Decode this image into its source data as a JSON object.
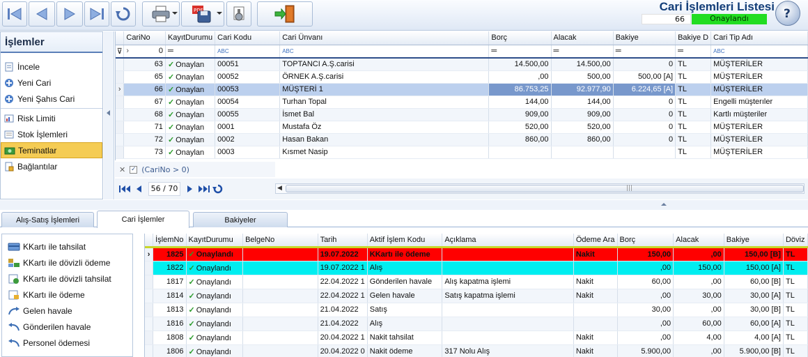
{
  "header": {
    "title": "Cari İşlemleri Listesi",
    "record_number": "66",
    "status": "Onaylandı"
  },
  "toolbar": {
    "icons": [
      "first-record-icon",
      "previous-record-icon",
      "next-record-icon",
      "last-record-icon",
      "refresh-icon",
      "print-icon",
      "pdf-save-icon",
      "settings-icon",
      "exit-icon",
      "help-icon"
    ]
  },
  "sidebar": {
    "title": "İşlemler",
    "items": [
      {
        "label": "İncele",
        "icon": "view-icon"
      },
      {
        "label": "Yeni Cari",
        "icon": "add-icon"
      },
      {
        "label": "Yeni Şahıs Cari",
        "icon": "add-icon"
      },
      {
        "label": "Risk Limiti",
        "icon": "risk-icon"
      },
      {
        "label": "Stok İşlemleri",
        "icon": "stock-icon"
      },
      {
        "label": "Teminatlar",
        "icon": "guarantee-icon"
      },
      {
        "label": "Bağlantılar",
        "icon": "link-icon"
      }
    ]
  },
  "top_grid": {
    "columns": [
      "CariNo",
      "KayıtDurumu",
      "Cari Kodu",
      "Cari Ünvanı",
      "Borç",
      "Alacak",
      "Bakiye",
      "Bakiye D",
      "Cari Tip Adı"
    ],
    "filter_row": {
      "cari_no": "0"
    },
    "rows": [
      {
        "cari_no": "63",
        "durum": "Onaylan",
        "kod": "00051",
        "unvan": "TOPTANCI A.Ş.carisi",
        "borc": "14.500,00",
        "alacak": "14.500,00",
        "bakiye": "0",
        "doviz": "TL",
        "tip": "MÜŞTERİLER"
      },
      {
        "cari_no": "65",
        "durum": "Onaylan",
        "kod": "00052",
        "unvan": "ÖRNEK A.Ş.carisi",
        "borc": ",00",
        "alacak": "500,00",
        "bakiye": "500,00 [A]",
        "doviz": "TL",
        "tip": "MÜŞTERİLER"
      },
      {
        "cari_no": "66",
        "durum": "Onaylan",
        "kod": "00053",
        "unvan": "MÜŞTERİ 1",
        "borc": "86.753,25",
        "alacak": "92.977,90",
        "bakiye": "6.224,65 [A]",
        "doviz": "TL",
        "tip": "MÜŞTERİLER"
      },
      {
        "cari_no": "67",
        "durum": "Onaylan",
        "kod": "00054",
        "unvan": "Turhan Topal",
        "borc": "144,00",
        "alacak": "144,00",
        "bakiye": "0",
        "doviz": "TL",
        "tip": "Engelli müşterıler"
      },
      {
        "cari_no": "68",
        "durum": "Onaylan",
        "kod": "00055",
        "unvan": "İsmet Bal",
        "borc": "909,00",
        "alacak": "909,00",
        "bakiye": "0",
        "doviz": "TL",
        "tip": "Kartlı müşteriler"
      },
      {
        "cari_no": "71",
        "durum": "Onaylan",
        "kod": "0001",
        "unvan": "Mustafa Öz",
        "borc": "520,00",
        "alacak": "520,00",
        "bakiye": "0",
        "doviz": "TL",
        "tip": "MÜŞTERİLER"
      },
      {
        "cari_no": "72",
        "durum": "Onaylan",
        "kod": "0002",
        "unvan": "Hasan Bakan",
        "borc": "860,00",
        "alacak": "860,00",
        "bakiye": "0",
        "doviz": "TL",
        "tip": "MÜŞTERİLER"
      },
      {
        "cari_no": "73",
        "durum": "Onaylan",
        "kod": "0003",
        "unvan": "Kısmet Nasip",
        "borc": "",
        "alacak": "",
        "bakiye": "",
        "doviz": "TL",
        "tip": "MÜŞTERİLER"
      }
    ],
    "filter_text": "(CariNo > 0)",
    "page": "56 / 70"
  },
  "tabs": [
    "Alış-Satış İşlemleri",
    "Cari İşlemler",
    "Bakiyeler"
  ],
  "bottom_ops": [
    {
      "label": "KKartı ile tahsilat",
      "icon": "card-collect-icon"
    },
    {
      "label": "KKartı ile dövizli ödeme",
      "icon": "card-fx-pay-icon"
    },
    {
      "label": "KKartı ile dövizli tahsilat",
      "icon": "card-fx-collect-icon"
    },
    {
      "label": "KKartı ile ödeme",
      "icon": "card-pay-icon"
    },
    {
      "label": "Gelen havale",
      "icon": "incoming-transfer-icon"
    },
    {
      "label": "Gönderilen havale",
      "icon": "outgoing-transfer-icon"
    },
    {
      "label": "Personel ödemesi",
      "icon": "staff-payment-icon"
    }
  ],
  "bottom_grid": {
    "columns": [
      "İşlemNo",
      "KayıtDurumu",
      "BelgeNo",
      "Tarih",
      "Aktif İşlem Kodu",
      "Açıklama",
      "Ödeme Ara",
      "Borç",
      "Alacak",
      "Bakiye",
      "Döviz"
    ],
    "rows": [
      {
        "no": "1825",
        "durum": "Onaylandı",
        "belge": "",
        "tarih": "19.07.2022",
        "kod": "KKartı ile ödeme",
        "aciklama": "",
        "odeme": "Nakit",
        "borc": "150,00",
        "alacak": ",00",
        "bakiye": "150,00 [B]",
        "doviz": "TL"
      },
      {
        "no": "1822",
        "durum": "Onaylandı",
        "belge": "",
        "tarih": "19.07.2022 1",
        "kod": "Alış",
        "aciklama": "",
        "odeme": "",
        "borc": ",00",
        "alacak": "150,00",
        "bakiye": "150,00 [A]",
        "doviz": "TL"
      },
      {
        "no": "1817",
        "durum": "Onaylandı",
        "belge": "",
        "tarih": "22.04.2022 1",
        "kod": "Gönderilen havale",
        "aciklama": "Alış kapatma işlemi",
        "odeme": "Nakit",
        "borc": "60,00",
        "alacak": ",00",
        "bakiye": "60,00 [B]",
        "doviz": "TL"
      },
      {
        "no": "1814",
        "durum": "Onaylandı",
        "belge": "",
        "tarih": "22.04.2022 1",
        "kod": "Gelen havale",
        "aciklama": "Satış kapatma işlemi",
        "odeme": "Nakit",
        "borc": ",00",
        "alacak": "30,00",
        "bakiye": "30,00 [A]",
        "doviz": "TL"
      },
      {
        "no": "1813",
        "durum": "Onaylandı",
        "belge": "",
        "tarih": "21.04.2022",
        "kod": "Satış",
        "aciklama": "",
        "odeme": "",
        "borc": "30,00",
        "alacak": ",00",
        "bakiye": "30,00 [B]",
        "doviz": "TL"
      },
      {
        "no": "1816",
        "durum": "Onaylandı",
        "belge": "",
        "tarih": "21.04.2022",
        "kod": "Alış",
        "aciklama": "",
        "odeme": "",
        "borc": ",00",
        "alacak": "60,00",
        "bakiye": "60,00 [A]",
        "doviz": "TL"
      },
      {
        "no": "1808",
        "durum": "Onaylandı",
        "belge": "",
        "tarih": "20.04.2022 1",
        "kod": "Nakit tahsilat",
        "aciklama": "",
        "odeme": "Nakit",
        "borc": ",00",
        "alacak": "4,00",
        "bakiye": "4,00 [A]",
        "doviz": "TL"
      },
      {
        "no": "1806",
        "durum": "Onaylandı",
        "belge": "",
        "tarih": "20.04.2022 0",
        "kod": "Nakit ödeme",
        "aciklama": "317 Nolu Alış",
        "odeme": "Nakit",
        "borc": "5.900,00",
        "alacak": ",00",
        "bakiye": "5.900,00 [B]",
        "doviz": "TL"
      }
    ]
  },
  "colors": {
    "accent": "#123d78",
    "status_green": "#22dd22",
    "selected_row": "#7898cc",
    "red_row": "#ff0000",
    "cyan_row": "#00eef0",
    "sidebar_selected": "#f5cc54"
  }
}
